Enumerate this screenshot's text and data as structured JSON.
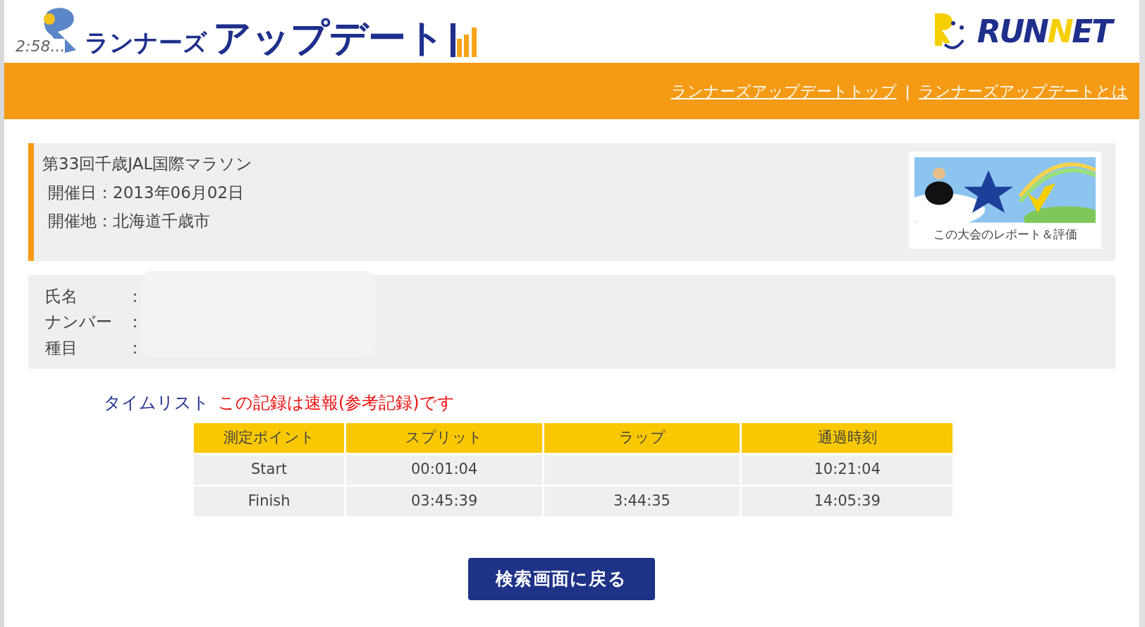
{
  "header": {
    "logo_clock": "2:58...",
    "logo_small": "ランナーズ",
    "logo_large": "アップデート",
    "brand_parts": [
      {
        "text": "RUN",
        "color": "#1e2f8c"
      },
      {
        "text": "N",
        "color": "#f6cf00"
      },
      {
        "text": "ET",
        "color": "#1e2f8c"
      }
    ]
  },
  "nav": {
    "links": [
      "ランナーズアップデートトップ",
      "ランナーズアップデートとは"
    ],
    "separator": "|"
  },
  "event": {
    "title": "第33回千歳JAL国際マラソン",
    "fields": [
      {
        "label": "開催日：",
        "value": "2013年06月02日"
      },
      {
        "label": "開催地：",
        "value": "北海道千歳市"
      }
    ],
    "banner": {
      "kind": "picture",
      "caption": "この大会のレポート＆評価"
    }
  },
  "runner": {
    "fields": [
      {
        "label": "氏名",
        "separator": "："
      },
      {
        "label": "ナンバー",
        "separator": "："
      },
      {
        "label": "種目",
        "separator": "："
      }
    ],
    "redacted": true
  },
  "timelist": {
    "title": "タイムリスト",
    "notice": "この記録は速報(参考記録)です",
    "columns": [
      "測定ポイント",
      "スプリット",
      "ラップ",
      "通過時刻"
    ],
    "rows": [
      {
        "cells": [
          "Start",
          "00:01:04",
          null,
          "10:21:04"
        ]
      },
      {
        "cells": [
          "Finish",
          "03:45:39",
          "3:44:35",
          "14:05:39"
        ]
      }
    ]
  },
  "back_button": "検索画面に戻る"
}
